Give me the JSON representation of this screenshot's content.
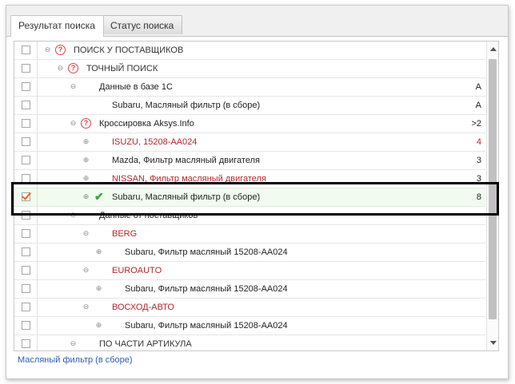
{
  "tabs": [
    {
      "label": "Результат поиска",
      "active": true
    },
    {
      "label": "Статус поиска",
      "active": false
    }
  ],
  "rows": [
    {
      "label": "ПОИСК У ПОСТАВЩИКОВ",
      "value": "",
      "checked": false,
      "toggle": "⊖",
      "icon": "question"
    },
    {
      "label": "ТОЧНЫЙ ПОИСК",
      "value": "",
      "checked": false,
      "toggle": "⊖",
      "icon": "question"
    },
    {
      "label": "Данные в базе 1С",
      "value": "А",
      "checked": false,
      "toggle": "⊖",
      "icon": ""
    },
    {
      "label": "Subaru, Масляный фильтр (в сборе)",
      "value": "А",
      "checked": false,
      "toggle": "",
      "icon": ""
    },
    {
      "label": "Кроссировка Aksys.Info",
      "value": ">2",
      "checked": false,
      "toggle": "⊖",
      "icon": "question"
    },
    {
      "label": "ISUZU, 15208-AA024",
      "value": "4",
      "checked": false,
      "toggle": "⊕",
      "icon": ""
    },
    {
      "label": "Mazda, Фильтр масляный двигателя",
      "value": "3",
      "checked": false,
      "toggle": "⊕",
      "icon": ""
    },
    {
      "label": "NISSAN, Фильтр масляный двигателя",
      "value": "3",
      "checked": false,
      "toggle": "⊕",
      "icon": ""
    },
    {
      "label": "Subaru, Масляный фильтр (в сборе)",
      "value": "8",
      "checked": true,
      "toggle": "⊕",
      "icon": "check"
    },
    {
      "label": "Данные от поставщиков",
      "value": "",
      "checked": false,
      "toggle": "⊖",
      "icon": ""
    },
    {
      "label": "BERG",
      "value": "",
      "checked": false,
      "toggle": "⊖",
      "icon": ""
    },
    {
      "label": "Subaru, Фильтр масляный 15208-AA024",
      "value": "",
      "checked": false,
      "toggle": "⊕",
      "icon": ""
    },
    {
      "label": "EUROAUTO",
      "value": "",
      "checked": false,
      "toggle": "⊖",
      "icon": ""
    },
    {
      "label": "Subaru, Фильтр масляный 15208-AA024",
      "value": "",
      "checked": false,
      "toggle": "⊕",
      "icon": ""
    },
    {
      "label": "ВОСХОД-АВТО",
      "value": "",
      "checked": false,
      "toggle": "⊖",
      "icon": ""
    },
    {
      "label": "Subaru, Фильтр масляный 15208-AA024",
      "value": "",
      "checked": false,
      "toggle": "⊕",
      "icon": ""
    },
    {
      "label": "ПО ЧАСТИ АРТИКУЛА",
      "value": "",
      "checked": false,
      "toggle": "⊖",
      "icon": ""
    }
  ],
  "footer_link": "Масляный фильтр (в сборе)",
  "colors": {
    "supplier_red": "#b3262b",
    "check_orange": "#e06a1a",
    "ok_green": "#3aa53a",
    "link_blue": "#2a5fb0"
  }
}
